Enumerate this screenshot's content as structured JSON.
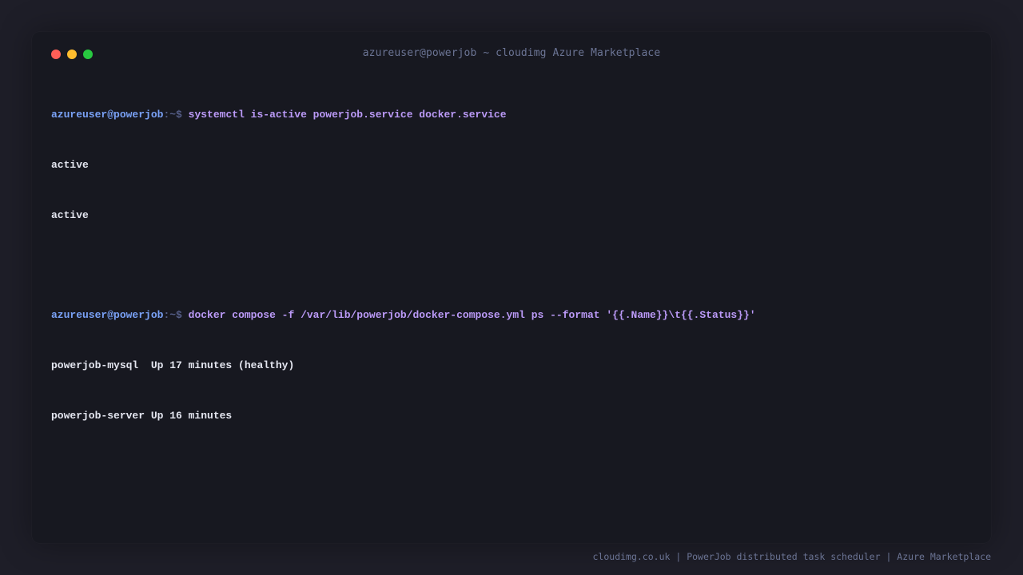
{
  "window": {
    "title": "azureuser@powerjob ~ cloudimg Azure Marketplace",
    "traffic_lights": [
      "close",
      "minimize",
      "zoom"
    ],
    "colors": {
      "close": "#ff5f57",
      "minimize": "#febc2e",
      "zoom": "#28c840",
      "prompt_user": "#7aa2f7",
      "command": "#bb9af7",
      "background": "#171820"
    }
  },
  "terminal": {
    "prompt_user": "azureuser@powerjob",
    "prompt_path": ":~$",
    "commands": [
      {
        "command": "systemctl is-active powerjob.service docker.service",
        "output": [
          "active",
          "active"
        ]
      },
      {
        "command": "docker compose -f /var/lib/powerjob/docker-compose.yml ps --format '{{.Name}}\\t{{.Status}}'",
        "output": [
          "powerjob-mysql  Up 17 minutes (healthy)",
          "powerjob-server Up 16 minutes"
        ]
      }
    ]
  },
  "footer": {
    "text": "cloudimg.co.uk | PowerJob distributed task scheduler | Azure Marketplace"
  }
}
